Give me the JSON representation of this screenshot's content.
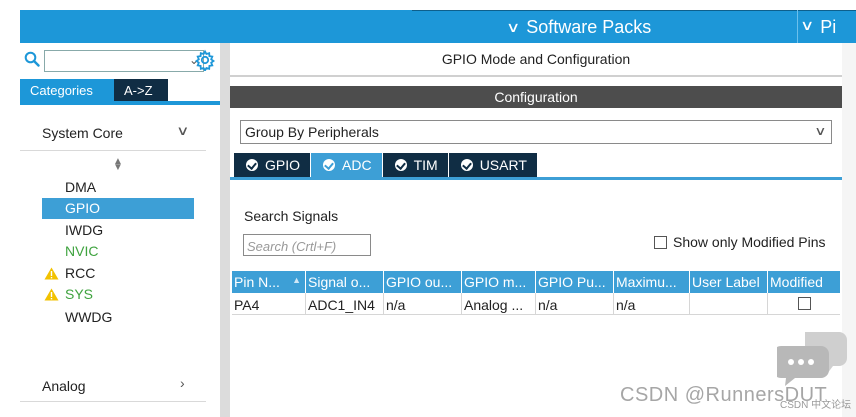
{
  "topbar": {
    "software_packs_label": "Software Packs",
    "pinout_label_partial": "Pi"
  },
  "left": {
    "search": {
      "value": ""
    },
    "tabs": {
      "categories": "Categories",
      "az": "A->Z"
    },
    "section_title": "System Core",
    "items": [
      {
        "label": "DMA",
        "state": "normal"
      },
      {
        "label": "GPIO",
        "state": "selected"
      },
      {
        "label": "IWDG",
        "state": "normal"
      },
      {
        "label": "NVIC",
        "state": "enabled"
      },
      {
        "label": "RCC",
        "state": "warning"
      },
      {
        "label": "SYS",
        "state": "warning"
      },
      {
        "label": "WWDG",
        "state": "normal"
      }
    ],
    "analog_label": "Analog"
  },
  "right": {
    "title": "GPIO Mode and Configuration",
    "config_label": "Configuration",
    "group_by": "Group By Peripherals",
    "tabs": [
      "GPIO",
      "ADC",
      "TIM",
      "USART"
    ],
    "active_tab": "ADC",
    "search_signals_label": "Search Signals",
    "search_placeholder": "Search (Crtl+F)",
    "show_modified_label": "Show only Modified Pins",
    "table": {
      "headers": [
        "Pin N...",
        "Signal o...",
        "GPIO ou...",
        "GPIO m...",
        "GPIO Pu...",
        "Maximu...",
        "User Label",
        "Modified"
      ],
      "rows": [
        [
          "PA4",
          "ADC1_IN4",
          "n/a",
          "Analog ...",
          "n/a",
          "n/a",
          "",
          ""
        ]
      ]
    }
  },
  "watermark": {
    "text": "CSDN @RunnersDUT",
    "small": "CSDN 中文论坛"
  },
  "colors": {
    "accent_blue": "#1d97d8",
    "selected_blue": "#3d9fd6",
    "dark_navy": "#102d44",
    "config_bar": "#4d4d4d",
    "nvic_green": "#3fa33f",
    "warning_yellow": "#f2c200"
  }
}
